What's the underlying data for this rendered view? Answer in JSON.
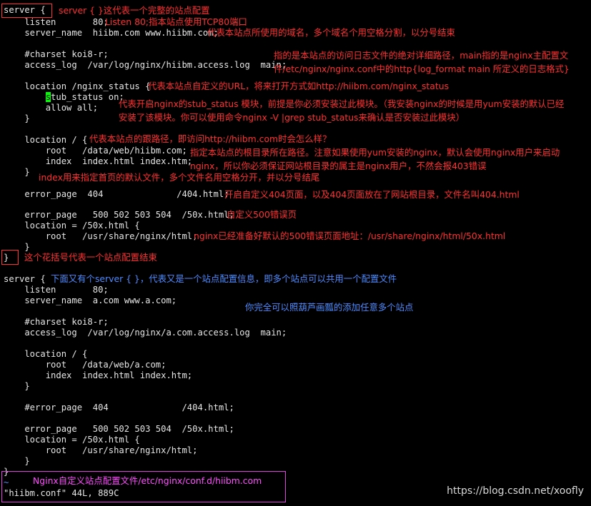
{
  "code": {
    "l01": "server {",
    "l02": "    listen       80;",
    "l03": "    server_name  hiibm.com www.hiibm.com;",
    "l04": "    #charset koi8-r;",
    "l05": "    access_log  /var/log/nginx/hiibm.access.log  main;",
    "l06": "    location /nginx_status {",
    "l07_cursor": "s",
    "l07_rest": "tub_status on;",
    "l08": "        allow all;",
    "l09": "    }",
    "l10": "    location / {",
    "l11": "        root   /data/web/hiibm.com;",
    "l12": "        index  index.html index.htm;",
    "l13": "    }",
    "l14": "    error_page  404              /404.html;",
    "l15": "    error_page   500 502 503 504  /50x.html;",
    "l16": "    location = /50x.html {",
    "l17": "        root   /usr/share/nginx/html;",
    "l18": "    }",
    "l19": "}",
    "l20": "server {",
    "l21": "    listen       80;",
    "l22": "    server_name  a.com www.a.com;",
    "l23": "    #charset koi8-r;",
    "l24": "    access_log  /var/log/nginx/a.com.access.log  main;",
    "l25": "    location / {",
    "l26": "        root   /data/web/a.com;",
    "l27": "        index  index.html index.htm;",
    "l28": "    }",
    "l29": "    #error_page  404              /404.html;",
    "l30": "    error_page   500 502 503 504  /50x.html;",
    "l31": "    location = /50x.html {",
    "l32": "        root   /usr/share/nginx/html;",
    "l33": "    }",
    "l34": "}",
    "tilde": "~",
    "status": "\"hiibm.conf\" 44L, 889C"
  },
  "annotations": {
    "a_server": "server { }这代表一个完整的站点配置",
    "a_listen": "Listen 80;指本站点使用TCP80端口",
    "a_servername": "代表本站点所使用的域名，多个域名个用空格分割，以分号结束",
    "a_log1": "指的是本站点的访问日志文件的绝对详细路径，main指的是nginx主配置文",
    "a_log2": "件/etc/nginx/nginx.conf中的http{log_format main 所定义的日志格式}",
    "a_status_loc": "代表本站点自定义的URL，将来打开方式如http://hiibm.com/nginx_status",
    "a_stub1": "代表开启nginx的stub_status 模块，前提是你必须安装过此模块。（我安装nginx的时候是用yum安装的默认已经",
    "a_stub2": "安装了该模块。你可以使用命令nginx -V |grep stub_status来确认是否安装过此模块）",
    "a_root_loc": "代表本站点的跟路径，即访问http://hiibm.com时会怎么样？",
    "a_root1": "指定本站点的根目录所在路径。注意如果使用yum安装的nginx，默认会使用nginx用户来启动",
    "a_root2": "nginx，所以你必须保证网站根目录的属主是nginx用户，不然会报403错误",
    "a_index": "index用来指定首页的默认文件，多个文件名用空格分开，并以分号结尾",
    "a_404": "开启自定义404页面，以及404页面放在了网站根目录，文件名叫404.html",
    "a_500": "自定义500错误页",
    "a_50x": "nginx已经准备好默认的500错误页面地址：/usr/share/nginx/html/50x.html",
    "a_close": "这个花括号代表一个站点配置结束",
    "a_server2": "下面又有个server { }，代表又是一个站点配置信息，即多个站点可以共用一个配置文件",
    "a_copy": "你完全可以照葫芦画瓢的添加任意多个站点",
    "a_file": "Nginx自定义站点配置文件/etc/nginx/conf.d/hiibm.com"
  },
  "watermark": "https://blog.csdn.net/xoofly"
}
